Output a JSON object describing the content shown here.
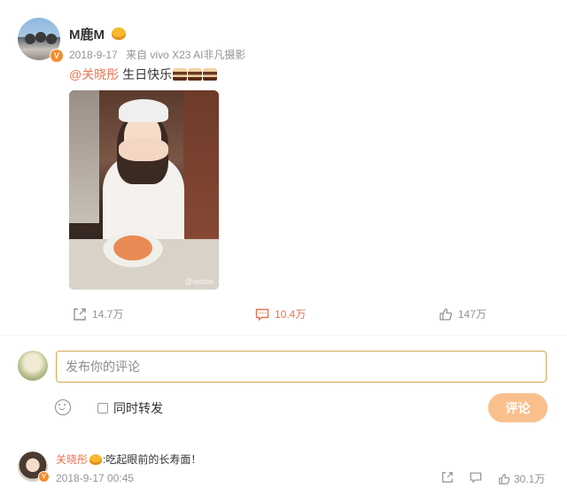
{
  "post": {
    "username": "M鹿M",
    "timestamp": "2018-9-17",
    "source": "来自 vivo X23 AI非凡摄影",
    "mention": "@关晓彤",
    "text": " 生日快乐",
    "photo_alt": "",
    "watermark": "@weibo"
  },
  "actions": {
    "repost_count": "14.7万",
    "comment_count": "10.4万",
    "like_count": "147万"
  },
  "composer": {
    "placeholder": "发布你的评论",
    "repost_checkbox_label": "同时转发",
    "submit_label": "评论"
  },
  "comment": {
    "author": "关晓彤",
    "separator": ":",
    "text": "吃起眼前的长寿面！",
    "time": "2018-9-17 00:45",
    "like_count": "30.1万"
  },
  "colors": {
    "accent": "#eb7350",
    "badge": "#f78b2a",
    "submit_bg": "#f9c08e",
    "input_border": "#d7a54d"
  },
  "icons": [
    "verified-badge-icon",
    "vip-crown-icon",
    "cake-emoji-icon",
    "share-icon",
    "comment-icon",
    "like-icon",
    "emoji-icon"
  ]
}
